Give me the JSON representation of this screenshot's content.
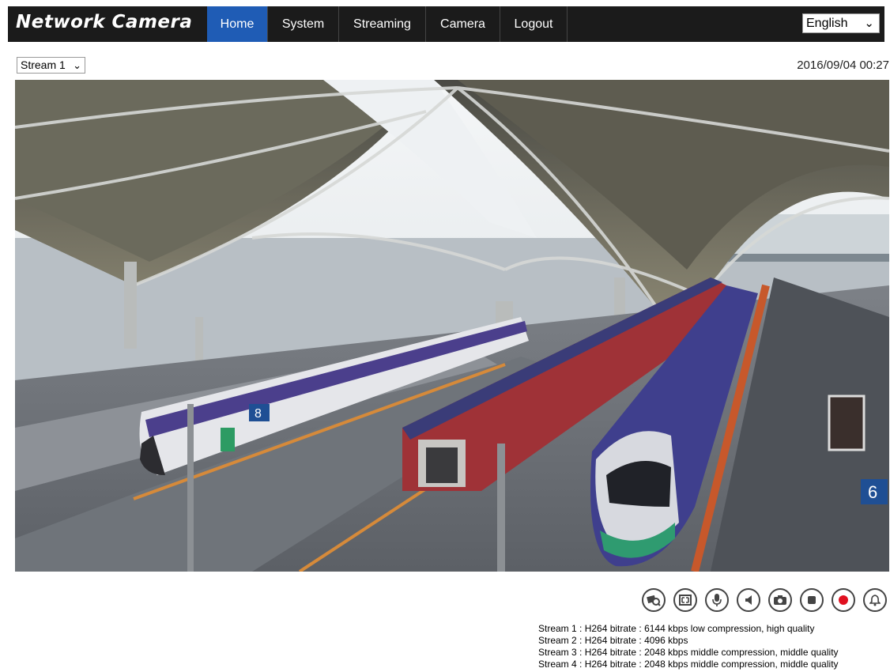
{
  "header": {
    "brand": "Network Camera",
    "nav": {
      "home": "Home",
      "system": "System",
      "streaming": "Streaming",
      "camera": "Camera",
      "logout": "Logout"
    },
    "language": "English"
  },
  "toolbar": {
    "stream_selected": "Stream 1",
    "datetime": "2016/09/04 00:27"
  },
  "controls": [
    {
      "name": "zoom-camera-icon",
      "color": "#444444"
    },
    {
      "name": "fit-screen-icon",
      "color": "#444444"
    },
    {
      "name": "microphone-icon",
      "color": "#444444"
    },
    {
      "name": "speaker-icon",
      "color": "#444444"
    },
    {
      "name": "snapshot-camera-icon",
      "color": "#444444"
    },
    {
      "name": "stop-icon",
      "color": "#444444"
    },
    {
      "name": "record-icon",
      "color": "#e01020"
    },
    {
      "name": "alarm-bell-icon",
      "color": "#444444"
    }
  ],
  "stream_info": {
    "s1": "Stream 1 : H264 bitrate : 6144 kbps low compression, high quality",
    "s2": "Stream 2 : H264 bitrate : 4096 kbps",
    "s3": "Stream 3 : H264 bitrate : 2048 kbps middle compression, middle quality",
    "s4": "Stream 4 : H264 bitrate : 2048 kbps middle compression, middle quality"
  },
  "video": {
    "platform_sign_left": "8",
    "platform_sign_right": "6"
  }
}
